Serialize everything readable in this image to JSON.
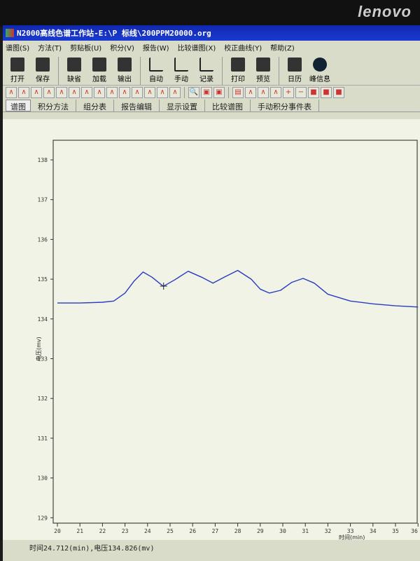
{
  "brand": "lenovo",
  "window": {
    "title": "N2000高线色谱工作站-E:\\P 标线\\200PPM20000.org"
  },
  "menu": [
    "谱图(S)",
    "方法(T)",
    "剪贴板(U)",
    "积分(V)",
    "报告(W)",
    "比较谱图(X)",
    "校正曲线(Y)",
    "帮助(Z)"
  ],
  "toolbar": [
    {
      "label": "打开",
      "icon": "open-folder-icon"
    },
    {
      "label": "保存",
      "icon": "save-icon"
    },
    {
      "label": "缺省",
      "icon": "document-icon"
    },
    {
      "label": "加载",
      "icon": "load-icon"
    },
    {
      "label": "输出",
      "icon": "export-icon"
    },
    {
      "label": "自动",
      "icon": "auto-integrate-icon"
    },
    {
      "label": "手动",
      "icon": "manual-integrate-icon"
    },
    {
      "label": "记录",
      "icon": "record-icon"
    },
    {
      "label": "打印",
      "icon": "printer-icon"
    },
    {
      "label": "预览",
      "icon": "preview-icon"
    },
    {
      "label": "日历",
      "icon": "calendar-icon"
    },
    {
      "label": "峰信息",
      "icon": "info-icon"
    }
  ],
  "tabs": [
    "谱图",
    "积分方法",
    "组分表",
    "报告编辑",
    "显示设置",
    "比较谱图",
    "手动积分事件表"
  ],
  "status": "时间24.712(min),电压134.826(mv)",
  "colors": {
    "trace": "#2a3cc0",
    "titlebar": "#1a3ad0"
  },
  "chart_data": {
    "type": "line",
    "xlabel": "时间(min)",
    "ylabel": "电压(mv)",
    "xlim": [
      20,
      36
    ],
    "ylim": [
      128.8,
      138.5
    ],
    "xticks": [
      20,
      21,
      22,
      23,
      24,
      25,
      26,
      27,
      28,
      29,
      30,
      31,
      32,
      33,
      34,
      35,
      36
    ],
    "yticks": [
      129,
      130,
      131,
      132,
      133,
      134,
      135,
      136,
      137,
      138
    ],
    "x": [
      20,
      21,
      22,
      22.5,
      23,
      23.4,
      23.8,
      24.2,
      24.7,
      25.2,
      25.8,
      26.4,
      26.9,
      27.4,
      28.0,
      28.6,
      29.0,
      29.4,
      29.9,
      30.4,
      30.9,
      31.4,
      32,
      33,
      34,
      35,
      36
    ],
    "y": [
      134.4,
      134.4,
      134.42,
      134.45,
      134.65,
      134.95,
      135.18,
      135.05,
      134.82,
      134.98,
      135.2,
      135.05,
      134.9,
      135.05,
      135.22,
      135.0,
      134.75,
      134.65,
      134.72,
      134.92,
      135.02,
      134.9,
      134.62,
      134.45,
      134.38,
      134.33,
      134.3
    ],
    "cursor": {
      "x": 24.712,
      "y": 134.826
    }
  }
}
